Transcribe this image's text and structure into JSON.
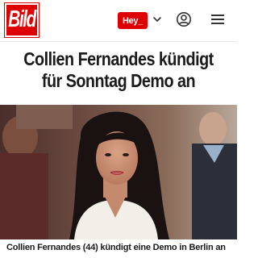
{
  "header": {
    "logo_text": "Bild",
    "hey_label": "Hey_",
    "colors": {
      "brand_red": "#de0000"
    },
    "icons": [
      "chevron-down-icon",
      "account-icon",
      "menu-icon"
    ]
  },
  "article": {
    "headline_line1": "Collien Fernandes kündigt",
    "headline_line2": "für Sonntag Demo an",
    "caption": "Collien Fernandes (44) kündigt eine Demo in Berlin an"
  }
}
